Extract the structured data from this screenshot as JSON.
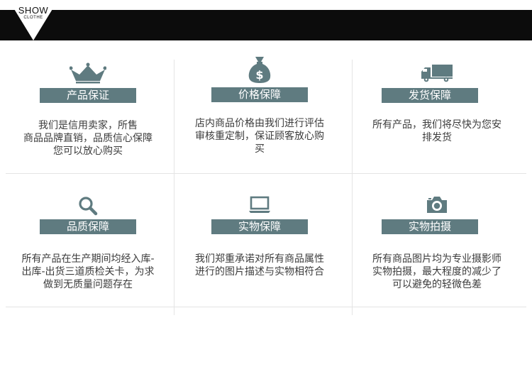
{
  "logo": {
    "main": "SHOW",
    "sub": "CLOTHE"
  },
  "colors": {
    "accent": "#5f7b80",
    "header": "#0c0c0c",
    "text": "#3c3c3c"
  },
  "features": [
    {
      "icon": "crown-icon",
      "title": "产品保证",
      "desc": [
        "我们是信用卖家，所售",
        "商品品牌直销，品质信心保障",
        "您可以放心购买"
      ]
    },
    {
      "icon": "money-bag-icon",
      "title": "价格保障",
      "desc": [
        "店内商品价格由我们进行评估",
        "审核重定制，保证顾客放心购",
        "买"
      ]
    },
    {
      "icon": "truck-icon",
      "title": "发货保障",
      "desc": [
        "所有产品，我们将尽快为您安",
        "排发货"
      ]
    },
    {
      "icon": "magnifier-icon",
      "title": "品质保障",
      "desc": [
        "所有产品在生产期间均经入库-",
        "出库-出货三道质检关卡，为求",
        "做到无质量问题存在"
      ]
    },
    {
      "icon": "monitor-icon",
      "title": "实物保障",
      "desc": [
        "我们郑重承诺对所有商品属性",
        "进行的图片描述与实物相符合"
      ]
    },
    {
      "icon": "camera-icon",
      "title": "实物拍摄",
      "desc": [
        "所有商品图片均为专业摄影师",
        "实物拍摄，最大程度的减少了",
        "可以避免的轻微色差"
      ]
    }
  ]
}
